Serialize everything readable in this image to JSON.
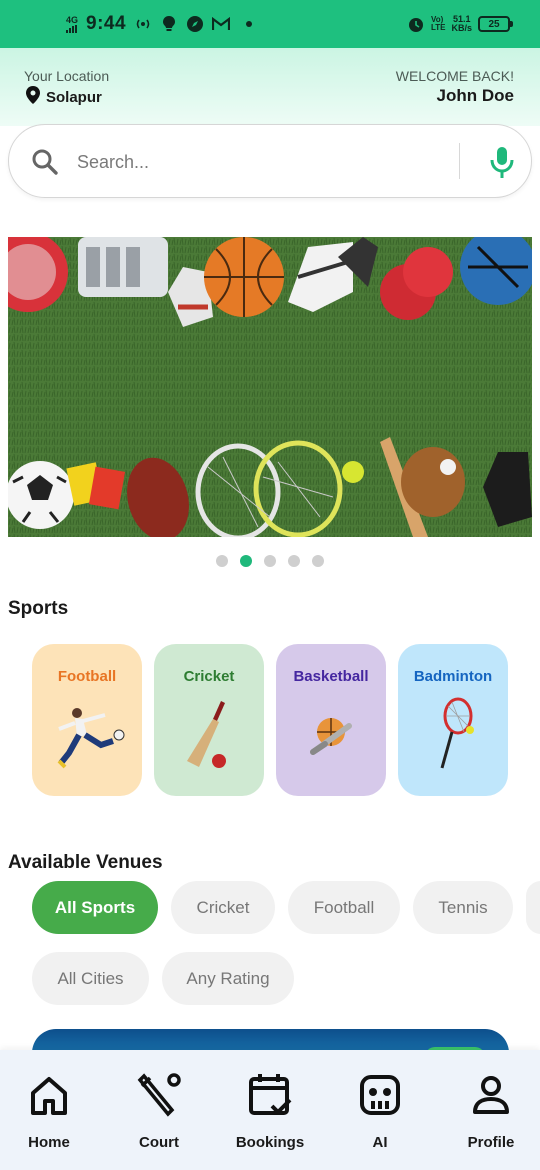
{
  "status_bar": {
    "network": "4G",
    "time": "9:44",
    "volte_top": "Vo)",
    "volte_bottom": "LTE",
    "speed_value": "51.1",
    "speed_unit": "KB/s",
    "battery": "25"
  },
  "header": {
    "location_label": "Your Location",
    "city": "Solapur",
    "welcome": "WELCOME BACK!",
    "user_name": "John Doe"
  },
  "search": {
    "placeholder": "Search...",
    "accent_color": "#1fb87b"
  },
  "carousel": {
    "active_index": 1,
    "count": 5
  },
  "sports": {
    "title": "Sports",
    "items": [
      {
        "name": "Football",
        "color": "#e87524",
        "bg": "#fde3b8"
      },
      {
        "name": "Cricket",
        "color": "#2e7d32",
        "bg": "#cfe9d2"
      },
      {
        "name": "Basketball",
        "color": "#4527a0",
        "bg": "#d6c9ea"
      },
      {
        "name": "Badminton",
        "color": "#1565c0",
        "bg": "#bfe6fb"
      }
    ]
  },
  "venues": {
    "title": "Available Venues",
    "sport_filters": [
      "All Sports",
      "Cricket",
      "Football",
      "Tennis"
    ],
    "other_filters": [
      "All Cities",
      "Any Rating"
    ],
    "active_color": "#46ab4a"
  },
  "bottom_nav": {
    "items": [
      {
        "label": "Home",
        "icon": "home-icon"
      },
      {
        "label": "Court",
        "icon": "court-icon"
      },
      {
        "label": "Bookings",
        "icon": "calendar-check-icon"
      },
      {
        "label": "AI",
        "icon": "robot-icon"
      },
      {
        "label": "Profile",
        "icon": "person-icon"
      }
    ]
  }
}
